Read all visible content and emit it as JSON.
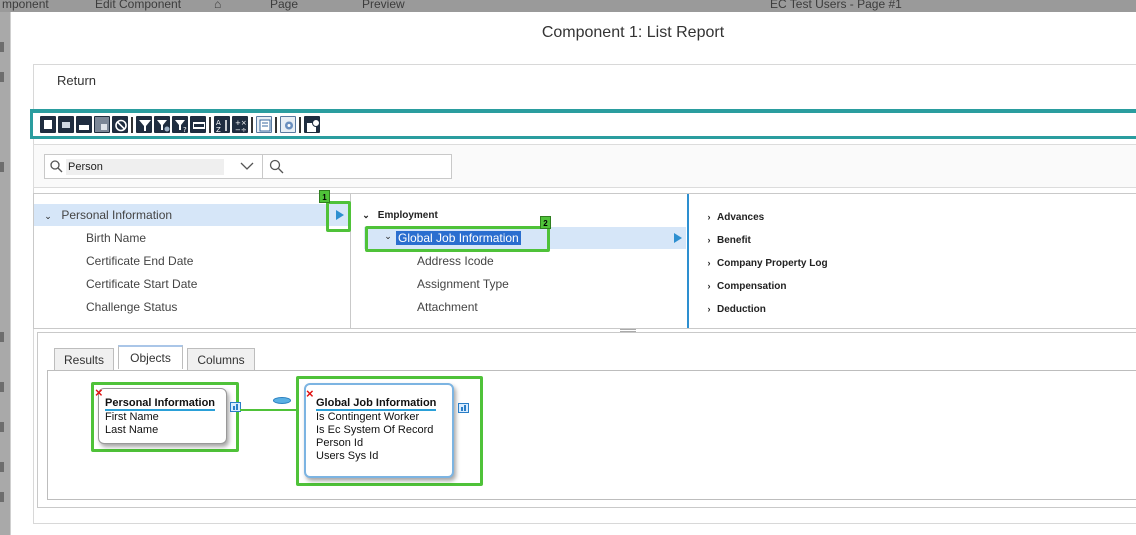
{
  "background": {
    "items": [
      "mponent",
      "Edit Component",
      "Page",
      "Preview",
      "EC Test Users - Page #1"
    ]
  },
  "dialog": {
    "title": "Component 1: List Report",
    "return_label": "Return"
  },
  "toolbar": {
    "icons": [
      "new-icon",
      "open-icon",
      "save-icon",
      "save-as-icon",
      "cancel-icon",
      "filter-icon",
      "filter-edit-icon",
      "filter-remove-icon",
      "format-icon",
      "sort-icon",
      "calculate-icon",
      "report-icon",
      "settings-icon",
      "schedule-icon"
    ]
  },
  "search": {
    "value": "Person"
  },
  "tree": {
    "col1": {
      "header": "Personal Information",
      "items": [
        "Birth Name",
        "Certificate End Date",
        "Certificate Start Date",
        "Challenge Status"
      ]
    },
    "col2": {
      "header": "Employment",
      "selected": "Global Job Information",
      "items": [
        "Address Icode",
        "Assignment Type",
        "Attachment"
      ]
    },
    "col3": {
      "items": [
        "Advances",
        "Benefit",
        "Company Property Log",
        "Compensation",
        "Deduction"
      ]
    },
    "badges": [
      "1",
      "2"
    ]
  },
  "tabs": {
    "results": "Results",
    "objects": "Objects",
    "columns": "Columns"
  },
  "objects": {
    "personal": {
      "title": "Personal Information",
      "fields": [
        "First Name",
        "Last Name"
      ]
    },
    "global": {
      "title": "Global Job Information",
      "fields": [
        "Is Contingent Worker",
        "Is Ec System Of Record",
        "Person Id",
        "Users Sys Id"
      ]
    },
    "remove_mark": "×"
  },
  "colors": {
    "teal": "#2a9d9f",
    "highlight_green": "#4fc239",
    "selection_blue": "#2a6ecf",
    "accent_blue": "#2d8fd0"
  }
}
